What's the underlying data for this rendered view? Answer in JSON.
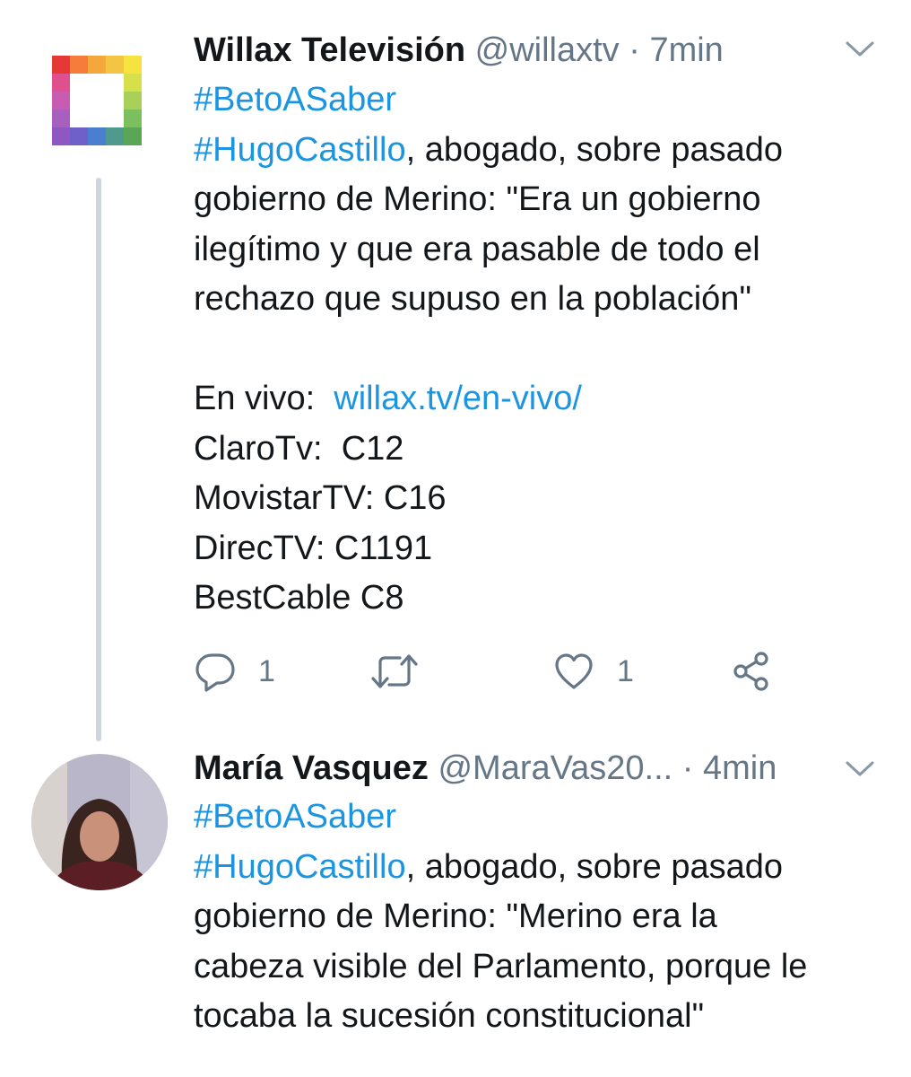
{
  "tweets": [
    {
      "name": "Willax Televisión",
      "handle": "@willaxtv",
      "separator": "·",
      "time": "7min",
      "avatar_icon": "willax-logo",
      "lines": {
        "l1": "#BetoASaber",
        "l2_tag": "#HugoCastillo",
        "l2_rest": ", abogado, sobre pasado",
        "l3": "gobierno de Merino: \"Era un gobierno",
        "l4": "ilegítimo y que era pasable de todo el",
        "l5": "rechazo que supuso en la población\"",
        "l6_prefix": "En vivo:  ",
        "l6_link": "willax.tv/en-vivo/",
        "l7": "ClaroTv:  C12",
        "l8": "MovistarTV: C16",
        "l9": "DirecTV: C1191",
        "l10": "BestCable C8"
      },
      "actions": {
        "reply_count": "1",
        "like_count": "1"
      }
    },
    {
      "name": "María Vasquez",
      "handle": "@MaraVas20...",
      "separator": "·",
      "time": "4min",
      "avatar_icon": "user-photo",
      "lines": {
        "l1": "#BetoASaber",
        "l2_tag": "#HugoCastillo",
        "l2_rest": ", abogado, sobre pasado",
        "l3": "gobierno de Merino: \"Merino era la",
        "l4": "cabeza visible del Parlamento, porque le",
        "l5": "tocaba la sucesión constitucional\""
      }
    }
  ],
  "colors": {
    "link": "#1b95e0",
    "secondary_text": "#657786",
    "thread_line": "#cdd6dd"
  },
  "icons": [
    "chevron-down-icon",
    "reply-icon",
    "retweet-icon",
    "like-icon",
    "share-icon"
  ]
}
